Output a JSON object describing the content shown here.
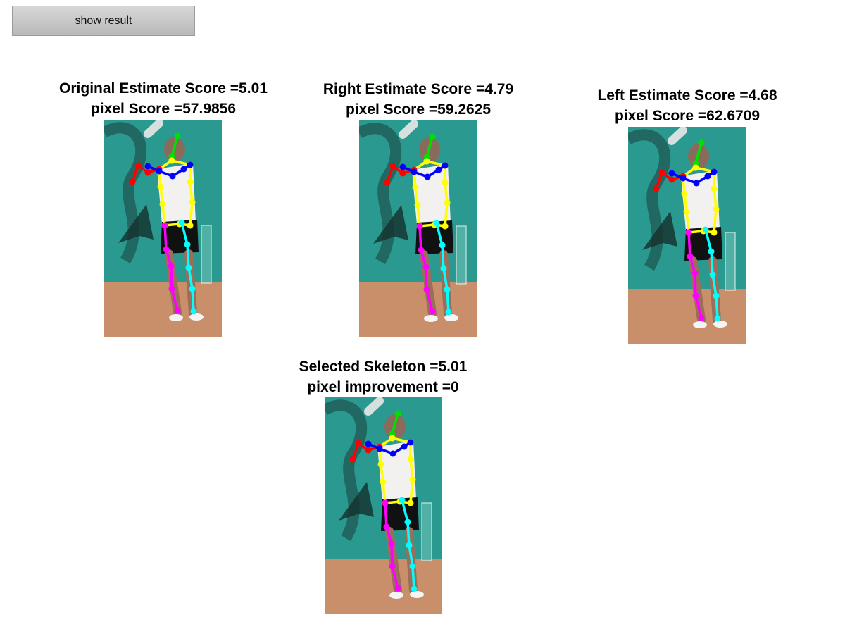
{
  "controls": {
    "show_result_label": "show result"
  },
  "panels": [
    {
      "title_line1": "Original Estimate Score =5.01",
      "title_line2": "pixel Score =57.9856"
    },
    {
      "title_line1": "Right Estimate Score =4.79",
      "title_line2": "pixel Score =59.2625"
    },
    {
      "title_line1": "Left Estimate Score =4.68",
      "title_line2": "pixel Score =62.6709"
    },
    {
      "title_line1": "Selected Skeleton =5.01",
      "title_line2": "pixel improvement =0"
    }
  ],
  "skeleton_colors": {
    "head": "#00e000",
    "torso": "#ffff00",
    "right_arm": "#ff0000",
    "left_arm": "#0000ff",
    "right_leg": "#ff00ff",
    "left_leg": "#00ffff"
  },
  "scene_colors": {
    "wall": "#2a9a90",
    "court": "#c98e6a"
  }
}
